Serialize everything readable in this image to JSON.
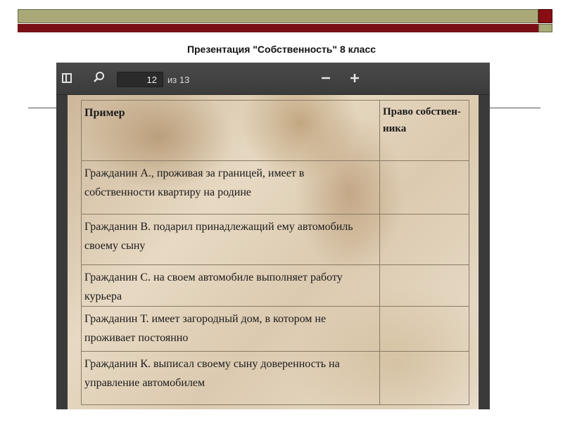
{
  "slide": {
    "title": "Презентация \"Собственность\" 8 класс",
    "colors": {
      "olive_bar": "#a8a878",
      "maroon_bar": "#7a0f16"
    }
  },
  "viewer": {
    "toolbar": {
      "sidebar_icon": "sidebar-toggle-icon",
      "search_icon": "magnifier-icon",
      "page_current": "12",
      "page_total_label": "из 13",
      "zoom_out_icon": "minus-icon",
      "zoom_in_icon": "plus-icon"
    },
    "table": {
      "headers": {
        "example": "Пример",
        "owner": "Право собствен-ника"
      },
      "rows": [
        {
          "example": "Гражданин А., проживая за границей, имеет в собственности квартиру на родине",
          "owner": ""
        },
        {
          "example": "Гражданин В. подарил принадлежащий ему автомобиль своему сыну",
          "owner": ""
        },
        {
          "example": "Гражданин С. на своем автомобиле выполняет работу курьера",
          "owner": ""
        },
        {
          "example": "Гражданин Т. имеет загородный дом, в котором не проживает постоянно",
          "owner": ""
        },
        {
          "example": "Гражданин К. выписал своему сыну доверенность на управление автомобилем",
          "owner": ""
        }
      ]
    }
  }
}
